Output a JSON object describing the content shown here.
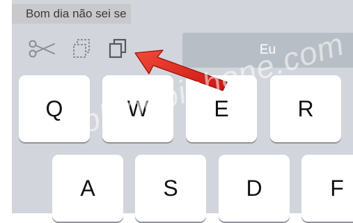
{
  "text_field": {
    "value": "Bom dia não sei se"
  },
  "shortcuts": {
    "cut_icon": "scissors-icon",
    "copy_icon": "copy-icon",
    "paste_icon": "paste-icon"
  },
  "suggestion": {
    "word": "Eu"
  },
  "keys": {
    "row1": [
      "Q",
      "W",
      "E",
      "R"
    ],
    "row2": [
      "A",
      "S",
      "D",
      "F"
    ]
  },
  "annotation": {
    "arrow_color": "#e8231b",
    "target": "paste-icon"
  },
  "watermark": {
    "text": "blogdoiphone.com"
  },
  "colors": {
    "keyboard_bg": "#d2d5db",
    "key_bg": "#ffffff",
    "suggestion_bg": "#b8bec5",
    "text_strip_bg": "#c9c9cb"
  }
}
